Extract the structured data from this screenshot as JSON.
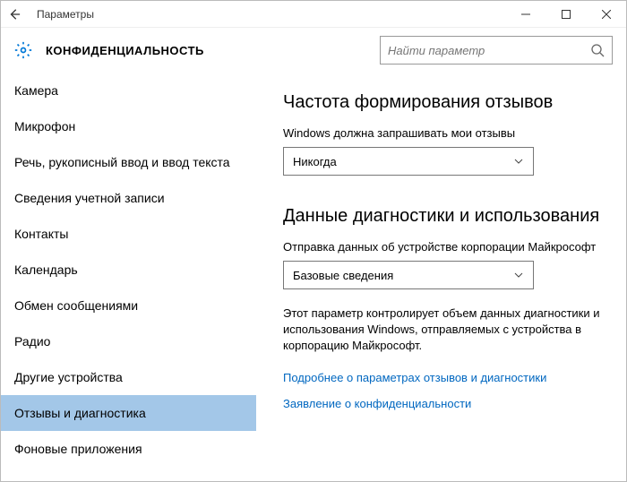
{
  "titlebar": {
    "title": "Параметры"
  },
  "header": {
    "title": "КОНФИДЕНЦИАЛЬНОСТЬ"
  },
  "search": {
    "placeholder": "Найти параметр"
  },
  "sidebar": {
    "items": [
      {
        "label": "Камера"
      },
      {
        "label": "Микрофон"
      },
      {
        "label": "Речь, рукописный ввод и ввод текста"
      },
      {
        "label": "Сведения учетной записи"
      },
      {
        "label": "Контакты"
      },
      {
        "label": "Календарь"
      },
      {
        "label": "Обмен сообщениями"
      },
      {
        "label": "Радио"
      },
      {
        "label": "Другие устройства"
      },
      {
        "label": "Отзывы и диагностика"
      },
      {
        "label": "Фоновые приложения"
      }
    ],
    "selected_index": 9
  },
  "content": {
    "section1": {
      "heading": "Частота формирования отзывов",
      "label": "Windows должна запрашивать мои отзывы",
      "value": "Никогда"
    },
    "section2": {
      "heading": "Данные диагностики и использования",
      "label": "Отправка данных об устройстве корпорации Майкрософт",
      "value": "Базовые сведения",
      "desc": "Этот параметр контролирует объем данных диагностики и использования Windows, отправляемых с устройства в корпорацию Майкрософт."
    },
    "links": {
      "more": "Подробнее о параметрах отзывов и диагностики",
      "privacy": "Заявление о конфиденциальности"
    }
  }
}
